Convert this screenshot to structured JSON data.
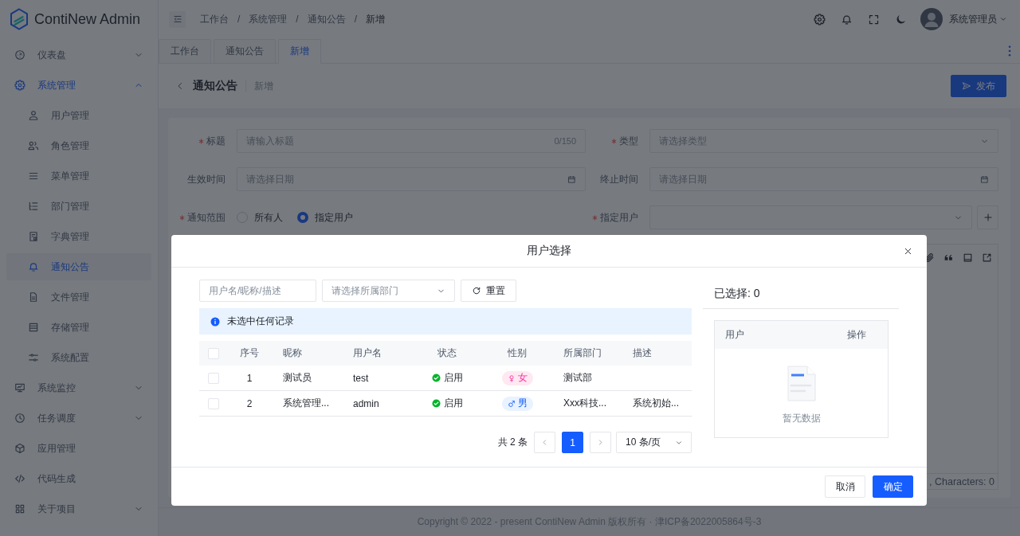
{
  "logo": {
    "text": "ContiNew Admin"
  },
  "sidebar": {
    "items": [
      {
        "label": "仪表盘",
        "selected": false,
        "expanded": false
      },
      {
        "label": "系统管理",
        "selected": true,
        "expanded": true,
        "children": [
          {
            "label": "用户管理",
            "selected": false
          },
          {
            "label": "角色管理",
            "selected": false
          },
          {
            "label": "菜单管理",
            "selected": false
          },
          {
            "label": "部门管理",
            "selected": false
          },
          {
            "label": "字典管理",
            "selected": false
          },
          {
            "label": "通知公告",
            "selected": true
          },
          {
            "label": "文件管理",
            "selected": false
          },
          {
            "label": "存储管理",
            "selected": false
          },
          {
            "label": "系统配置",
            "selected": false
          }
        ]
      },
      {
        "label": "系统监控",
        "selected": false,
        "expanded": false
      },
      {
        "label": "任务调度",
        "selected": false,
        "expanded": false
      },
      {
        "label": "应用管理",
        "selected": false
      },
      {
        "label": "代码生成",
        "selected": false
      },
      {
        "label": "关于项目",
        "selected": false,
        "expanded": false
      }
    ]
  },
  "header": {
    "breadcrumb": {
      "separator": "/",
      "items": [
        "工作台",
        "系统管理",
        "通知公告",
        "新增"
      ]
    },
    "user_name": "系统管理员"
  },
  "tabs": [
    {
      "label": "工作台",
      "selected": false
    },
    {
      "label": "通知公告",
      "selected": false
    },
    {
      "label": "新增",
      "selected": true
    }
  ],
  "page_header": {
    "title": "通知公告",
    "subtitle": "新增",
    "action_button": "发布"
  },
  "form": {
    "fields": [
      {
        "kind": "text",
        "label": "标题",
        "required": true,
        "placeholder": "请输入标题",
        "counter": "0/150"
      },
      {
        "kind": "select",
        "label": "类型",
        "required": true,
        "placeholder": "请选择类型"
      },
      {
        "kind": "date",
        "label": "生效时间",
        "required": false,
        "placeholder": "请选择日期"
      },
      {
        "kind": "date",
        "label": "终止时间",
        "required": false,
        "placeholder": "请选择日期"
      },
      {
        "kind": "radio",
        "label": "通知范围",
        "required": true,
        "options": [
          {
            "label": "所有人",
            "selected": false
          },
          {
            "label": "指定用户",
            "selected": true
          }
        ]
      },
      {
        "kind": "select_add",
        "label": "指定用户",
        "required": true
      }
    ],
    "editor": {
      "status": ", Characters: 0"
    }
  },
  "footer": {
    "text": "Copyright © 2022 - present ContiNew Admin 版权所有 · 津ICP备2022005864号-3"
  },
  "modal": {
    "title": "用户选择",
    "search": {
      "placeholder": "用户名/昵称/描述"
    },
    "department_select": {
      "placeholder": "请选择所属部门"
    },
    "reset_button": "重置",
    "alert": "未选中任何记录",
    "table": {
      "all_checked": false,
      "columns": [
        "序号",
        "昵称",
        "用户名",
        "状态",
        "性别",
        "所属部门",
        "描述"
      ],
      "rows": [
        {
          "checked": false,
          "index": "1",
          "nickname": "测试员",
          "username": "test",
          "status": {
            "kind": "enabled",
            "label": "启用"
          },
          "gender": {
            "kind": "female",
            "label": "女"
          },
          "department": "测试部"
        },
        {
          "checked": false,
          "index": "2",
          "nickname": "系统管理...",
          "username": "admin",
          "status": {
            "kind": "enabled",
            "label": "启用"
          },
          "gender": {
            "kind": "male",
            "label": "男"
          },
          "department": "Xxx科技...",
          "description": "系统初始..."
        }
      ]
    },
    "pagination": {
      "total": "共 2 条",
      "pages": [
        {
          "label": "1",
          "selected": true
        }
      ],
      "page_size": "10 条/页"
    },
    "selected_panel": {
      "title": "已选择: 0",
      "columns": [
        "用户",
        "操作"
      ],
      "empty_text": "暂无数据"
    },
    "buttons": {
      "cancel": "取消",
      "confirm": "确定"
    }
  }
}
